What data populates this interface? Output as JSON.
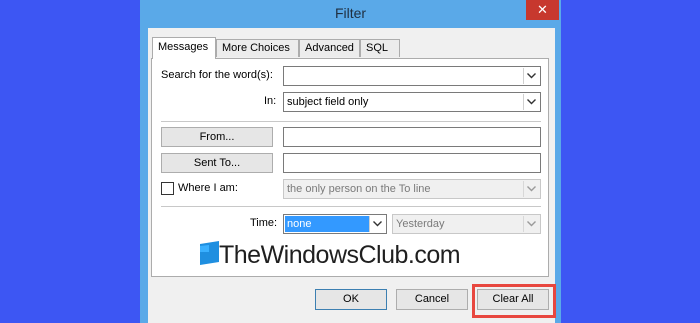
{
  "window": {
    "title": "Filter",
    "close_label": "✕"
  },
  "tabs": [
    {
      "label": "Messages",
      "active": true
    },
    {
      "label": "More Choices",
      "active": false
    },
    {
      "label": "Advanced",
      "active": false
    },
    {
      "label": "SQL",
      "active": false
    }
  ],
  "messages": {
    "search_label": "Search for the word(s):",
    "search_value": "",
    "in_label": "In:",
    "in_value": "subject field only",
    "from_button": "From...",
    "from_value": "",
    "sent_to_button": "Sent To...",
    "sent_to_value": "",
    "where_i_am_label": "Where I am:",
    "where_i_am_checked": false,
    "where_i_am_value": "the only person on the To line",
    "time_label": "Time:",
    "time_value": "none",
    "time_range_value": "Yesterday"
  },
  "buttons": {
    "ok": "OK",
    "cancel": "Cancel",
    "clear_all": "Clear All"
  },
  "watermark": {
    "text": "TheWindowsClub.com"
  },
  "colors": {
    "desktop": "#3d56f3",
    "title_bar": "#5aa9e8",
    "close_button": "#c7382e",
    "selection": "#3399ff",
    "highlight_box": "#e8473f"
  }
}
